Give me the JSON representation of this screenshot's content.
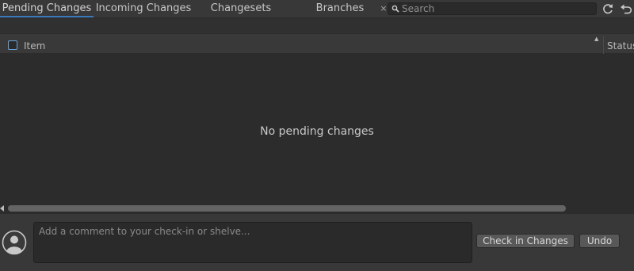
{
  "tabs": [
    {
      "label": "Pending Changes",
      "active": true
    },
    {
      "label": "Incoming Changes",
      "active": false
    },
    {
      "label": "Changesets",
      "active": false
    },
    {
      "label": "Branches",
      "active": false
    }
  ],
  "search": {
    "placeholder": "Search",
    "value": ""
  },
  "toolbar": {
    "refresh_icon": "refresh-icon",
    "undo_icon": "undo-arrow-icon"
  },
  "columns": {
    "item_label": "Item",
    "status_label": "Status"
  },
  "list": {
    "empty_message": "No pending changes",
    "rows": []
  },
  "comment": {
    "placeholder": "Add a comment to your check-in or shelve...",
    "value": ""
  },
  "actions": {
    "checkin_label": "Check in Changes",
    "undo_label": "Undo"
  },
  "colors": {
    "accent": "#3a79bb",
    "checkbox_border": "#6aa4db",
    "button": "#585858"
  }
}
